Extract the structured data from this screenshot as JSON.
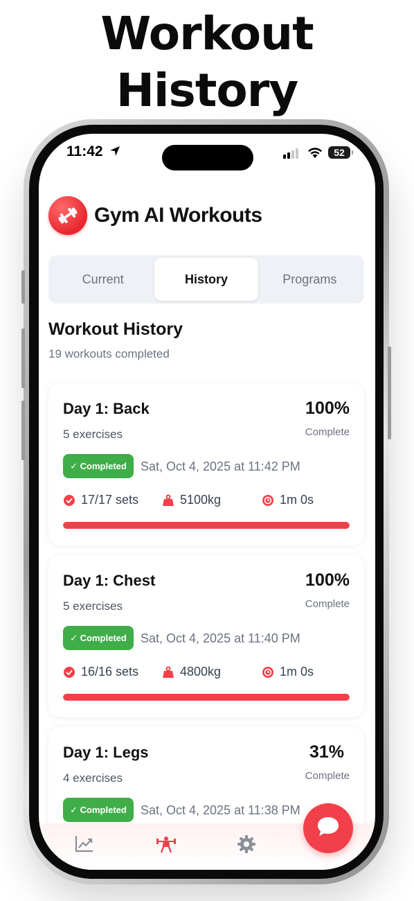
{
  "headline": {
    "line1": "Workout",
    "line2": "History"
  },
  "status_bar": {
    "time": "11:42",
    "battery": "52"
  },
  "app": {
    "title": "Gym AI Workouts"
  },
  "tabs": [
    {
      "label": "Current",
      "active": false
    },
    {
      "label": "History",
      "active": true
    },
    {
      "label": "Programs",
      "active": false
    }
  ],
  "section": {
    "title": "Workout History",
    "subtitle": "19 workouts completed"
  },
  "workouts": [
    {
      "name": "Day 1: Back",
      "exercises": "5 exercises",
      "percent": "100%",
      "percent_label": "Complete",
      "badge": "✓ Completed",
      "date": "Sat, Oct 4, 2025 at 11:42 PM",
      "sets": "17/17 sets",
      "weight": "5100kg",
      "duration": "1m 0s",
      "progress": 1.0
    },
    {
      "name": "Day 1: Chest",
      "exercises": "5 exercises",
      "percent": "100%",
      "percent_label": "Complete",
      "badge": "✓ Completed",
      "date": "Sat, Oct 4, 2025 at 11:40 PM",
      "sets": "16/16 sets",
      "weight": "4800kg",
      "duration": "1m 0s",
      "progress": 1.0
    },
    {
      "name": "Day 1: Legs",
      "exercises": "4 exercises",
      "percent": "31%",
      "percent_label": "Complete",
      "badge": "✓ Completed",
      "date": "Sat, Oct 4, 2025 at 11:38 PM",
      "progress": 0.31
    }
  ],
  "colors": {
    "accent": "#f2404a",
    "success": "#3fae49",
    "muted": "#6b7280"
  },
  "tabbar_icons": [
    "chart-icon",
    "weightlifter-icon",
    "gear-icon"
  ],
  "fab_icon": "chat-bubble-icon"
}
